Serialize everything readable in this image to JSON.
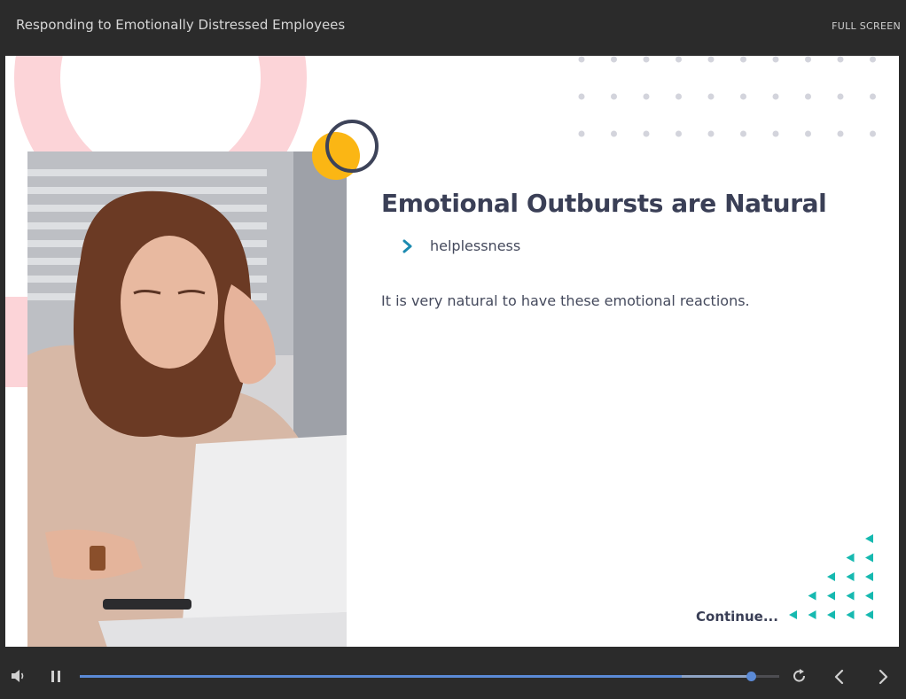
{
  "header": {
    "course_title": "Responding to Emotionally Distressed Employees",
    "fullscreen_label": "FULL SCREEN"
  },
  "slide": {
    "heading": "Emotional Outbursts are Natural",
    "bullets": [
      {
        "icon": "chevron-right-icon",
        "text": "helplessness"
      }
    ],
    "body": "It is very natural to have these emotional reactions.",
    "continue_label": "Continue...",
    "image": "woman-stressed-at-laptop"
  },
  "player": {
    "progress": 0.96,
    "buffered": 0.86,
    "icons": [
      "volume-icon",
      "pause-icon",
      "replay-icon",
      "previous-icon",
      "next-icon"
    ]
  },
  "colors": {
    "background": "#2b2b2b",
    "accent_teal": "#16b9b0",
    "chevron": "#1b8ab0",
    "heading": "#3a3f56",
    "progress": "#5b8ad6",
    "yellow": "#fbb614",
    "pink": "#fcd4d8"
  }
}
